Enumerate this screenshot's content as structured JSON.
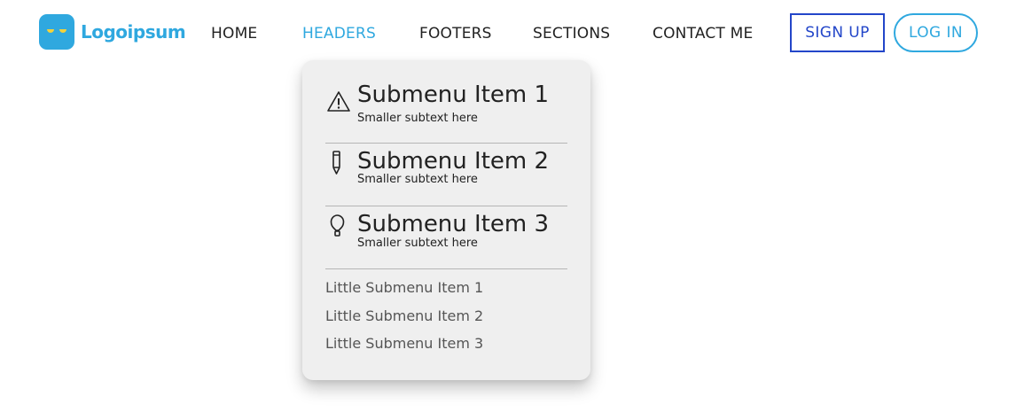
{
  "brand": {
    "name": "Logoipsum",
    "icon": "logo-face-icon",
    "color": "#2fa8df"
  },
  "nav": {
    "items": [
      {
        "label": "HOME",
        "active": false
      },
      {
        "label": "HEADERS",
        "active": true
      },
      {
        "label": "FOOTERS",
        "active": false
      },
      {
        "label": "SECTIONS",
        "active": false
      },
      {
        "label": "CONTACT ME",
        "active": false
      }
    ],
    "active_color": "#2fa8df"
  },
  "actions": {
    "signup_label": "SIGN UP",
    "signup_color": "#2346c9",
    "login_label": "LOG IN",
    "login_color": "#2fa8df"
  },
  "dropdown": {
    "items": [
      {
        "title": "Submenu Item 1",
        "subtext": "Smaller subtext here",
        "icon": "warning-icon"
      },
      {
        "title": "Submenu Item 2",
        "subtext": "Smaller subtext here",
        "icon": "pencil-icon"
      },
      {
        "title": "Submenu Item 3",
        "subtext": "Smaller subtext here",
        "icon": "lightbulb-icon"
      }
    ],
    "little_items": [
      "Little Submenu Item 1",
      "Little Submenu Item 2",
      "Little Submenu Item 3"
    ]
  }
}
